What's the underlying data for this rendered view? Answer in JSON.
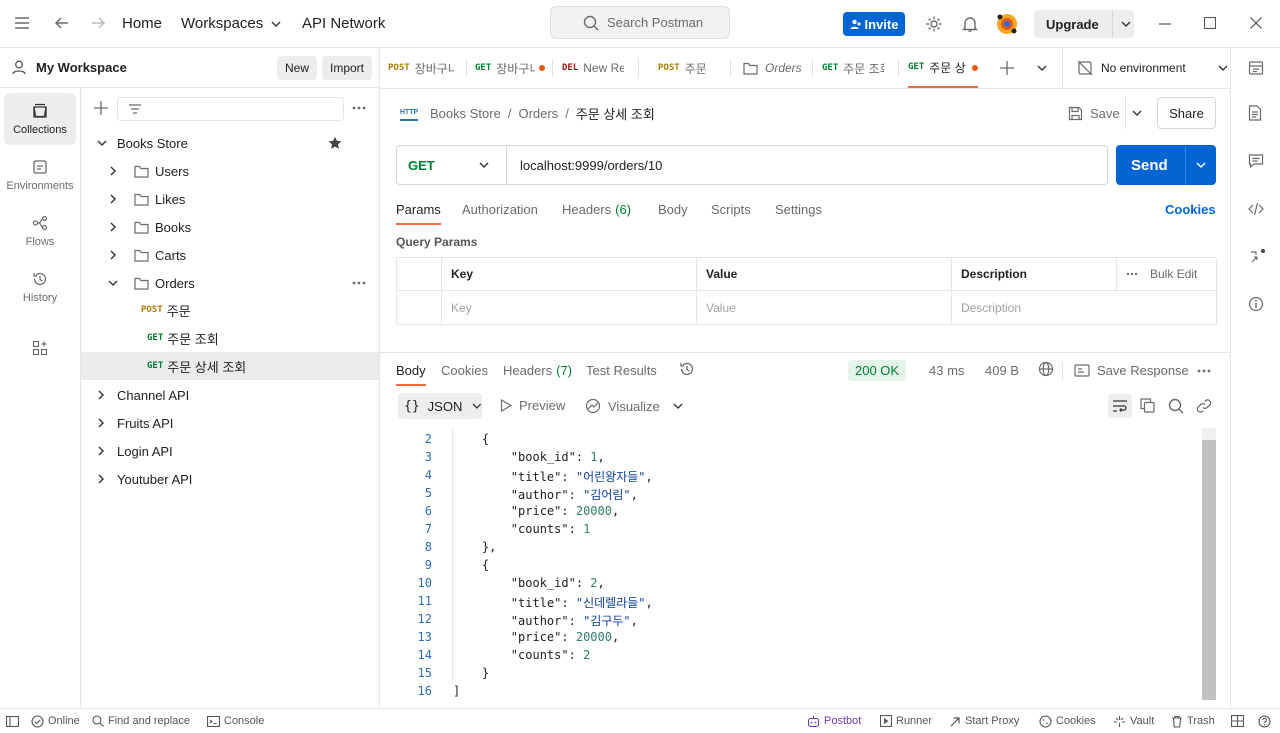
{
  "topbar": {
    "nav": [
      "Home",
      "Workspaces",
      "API Network"
    ],
    "search_placeholder": "Search Postman",
    "invite": "Invite",
    "upgrade": "Upgrade"
  },
  "workspace": {
    "name": "My Workspace",
    "new": "New",
    "import": "Import"
  },
  "rail": [
    {
      "label": "Collections",
      "icon": "collections-icon"
    },
    {
      "label": "Environments",
      "icon": "environments-icon"
    },
    {
      "label": "Flows",
      "icon": "flows-icon"
    },
    {
      "label": "History",
      "icon": "history-icon"
    }
  ],
  "tree": {
    "collection": "Books Store",
    "folders": [
      "Users",
      "Likes",
      "Books",
      "Carts",
      "Orders"
    ],
    "requests": [
      {
        "method": "POST",
        "name": "주문"
      },
      {
        "method": "GET",
        "name": "주문 조회"
      },
      {
        "method": "GET",
        "name": "주문 상세 조회"
      }
    ],
    "others": [
      "Channel API",
      "Fruits API",
      "Login API",
      "Youtuber API"
    ]
  },
  "tabs": [
    {
      "method": "POST",
      "label": "장바구니"
    },
    {
      "method": "GET",
      "label": "장바구니"
    },
    {
      "method": "DEL",
      "label": "New Re"
    },
    {
      "method": "POST",
      "label": "주문"
    },
    {
      "method": "",
      "label": "Orders"
    },
    {
      "method": "GET",
      "label": "주문 조회"
    },
    {
      "method": "GET",
      "label": "주문 상"
    }
  ],
  "environment": "No environment",
  "breadcrumb": {
    "icon_text": "HTTP",
    "parts": [
      "Books Store",
      "Orders",
      "주문 상세 조회"
    ]
  },
  "request": {
    "save": "Save",
    "share": "Share",
    "method": "GET",
    "url": "localhost:9999/orders/10",
    "send": "Send",
    "tabs": [
      "Params",
      "Authorization",
      "Headers",
      "Body",
      "Scripts",
      "Settings"
    ],
    "headers_count": "(6)",
    "cookies": "Cookies",
    "query_params_title": "Query Params",
    "columns": [
      "Key",
      "Value",
      "Description"
    ],
    "bulk_edit": "Bulk Edit",
    "placeholders": [
      "Key",
      "Value",
      "Description"
    ]
  },
  "response": {
    "tabs": [
      "Body",
      "Cookies",
      "Headers",
      "Test Results"
    ],
    "headers_count": "(7)",
    "status": "200 OK",
    "time": "43 ms",
    "size": "409 B",
    "save_response": "Save Response",
    "format": "JSON",
    "preview": "Preview",
    "visualize": "Visualize",
    "lines": [
      {
        "n": "2",
        "t": "    {"
      },
      {
        "n": "3",
        "t": "        \"book_id\": 1,"
      },
      {
        "n": "4",
        "t": "        \"title\": \"어린왕자들\","
      },
      {
        "n": "5",
        "t": "        \"author\": \"김어림\","
      },
      {
        "n": "6",
        "t": "        \"price\": 20000,"
      },
      {
        "n": "7",
        "t": "        \"counts\": 1"
      },
      {
        "n": "8",
        "t": "    },"
      },
      {
        "n": "9",
        "t": "    {"
      },
      {
        "n": "10",
        "t": "        \"book_id\": 2,"
      },
      {
        "n": "11",
        "t": "        \"title\": \"신데렐라들\","
      },
      {
        "n": "12",
        "t": "        \"author\": \"김구두\","
      },
      {
        "n": "13",
        "t": "        \"price\": 20000,"
      },
      {
        "n": "14",
        "t": "        \"counts\": 2"
      },
      {
        "n": "15",
        "t": "    }"
      },
      {
        "n": "16",
        "t": "]"
      }
    ]
  },
  "statusbar": {
    "online": "Online",
    "find_replace": "Find and replace",
    "console": "Console",
    "postbot": "Postbot",
    "runner": "Runner",
    "start_proxy": "Start Proxy",
    "cookies": "Cookies",
    "vault": "Vault",
    "trash": "Trash"
  },
  "colors": {
    "accent": "#0265d2",
    "post": "#ad7a03",
    "get": "#007f31",
    "del": "#8e1a10",
    "status_ok": "#007f31"
  }
}
